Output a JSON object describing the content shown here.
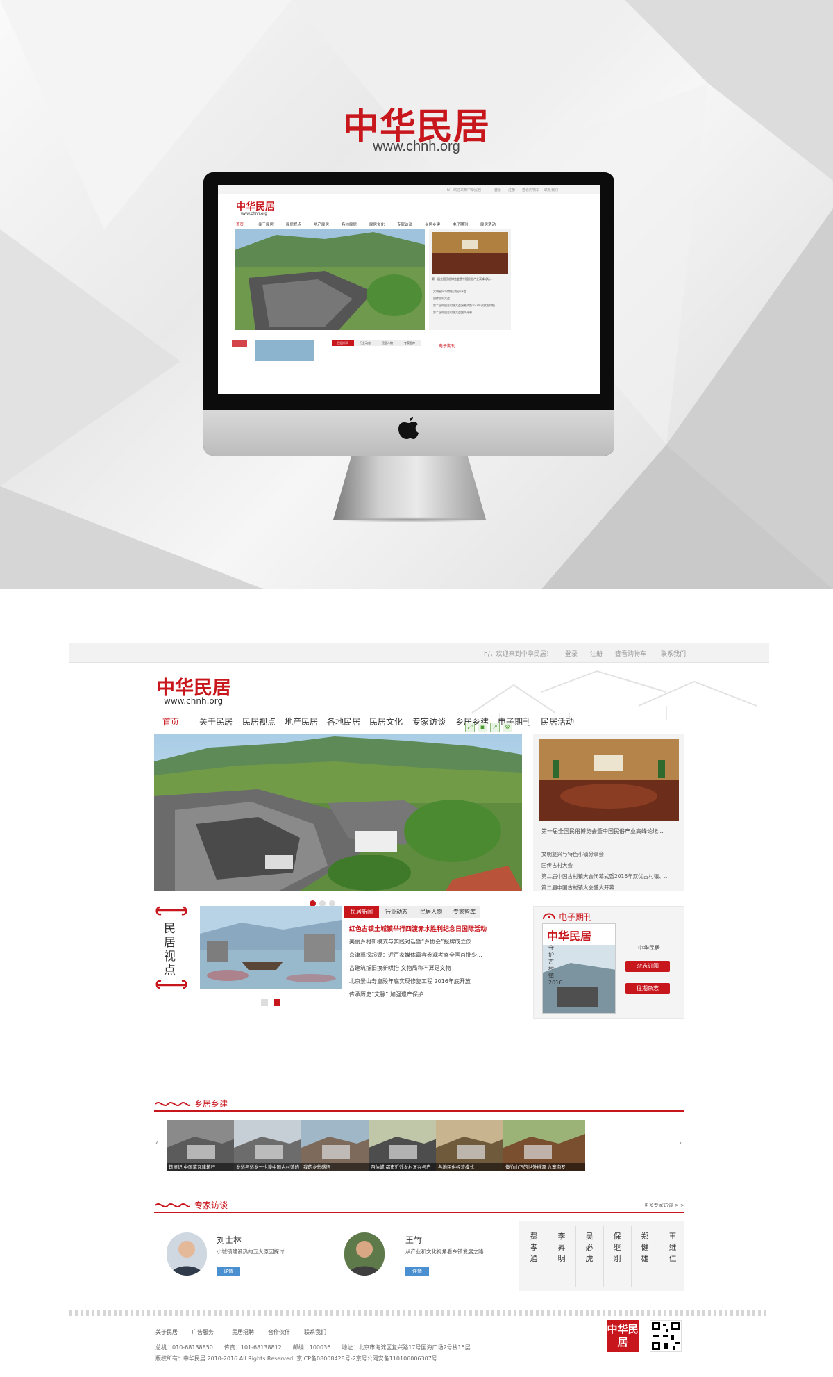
{
  "hero": {
    "logo_text": "中华民居",
    "url_text": "www.chnh.org",
    "apple_glyph": "apple-logo"
  },
  "mini": {
    "logo_text": "中华民居",
    "url_text": "www.chnh.org",
    "topbar": [
      "h/，欢迎来到中华民居！",
      "登录",
      "注册",
      "查看购物车",
      "联系我们"
    ],
    "nav": [
      "首页",
      "关于民居",
      "民居视点",
      "地产民居",
      "各地民居",
      "民居文化",
      "专家访谈",
      "乡居乡建",
      "电子期刊",
      "民居活动"
    ],
    "caption": "第一届全国民俗博览会暨中国民俗产业高峰论坛...",
    "list": [
      "文明复兴与特色小镇分享会",
      "国传古村大会",
      "第二届中国古村镇大会闭幕式暨2016年双优古村镇...",
      "第二届中国古村镇大会盛大开幕"
    ],
    "tabs": [
      "民居新闻",
      "行业动态",
      "民居人物",
      "专家智库"
    ],
    "mag_title": "电子期刊"
  },
  "site": {
    "topbar": {
      "welcome": "h/，欢迎来到中华民居！",
      "login": "登录",
      "register": "注册",
      "cart": "查看购物车",
      "contact": "联系我们"
    },
    "logo_text": "中华民居",
    "url_text": "www.chnh.org",
    "nav": [
      "首页",
      "关于民居",
      "民居视点",
      "地产民居",
      "各地民居",
      "民居文化",
      "专家访谈",
      "乡居乡建",
      "电子期刊",
      "民居活动"
    ],
    "toolbar_icons": [
      "expand-icon",
      "save-icon",
      "share-icon",
      "settings-icon"
    ],
    "featured": {
      "caption": "第一届全国民俗博览会暨中国民俗产业高峰论坛...",
      "list": [
        "文明复兴与特色小镇分享会",
        "国传古村大会",
        "第二届中国古村镇大会闭幕式暨2016年双优古村镇、...",
        "第二届中国古村镇大会盛大开幕"
      ]
    },
    "viewpoint": {
      "label_chars": [
        "民",
        "居",
        "视",
        "点"
      ],
      "tabs": [
        "民居新闻",
        "行业动态",
        "民居人物",
        "专家智库"
      ],
      "headline": "红色古镇土城镇举行四渡赤水胜利纪念日国际活动",
      "news": [
        "美丽乡村新模式与实践对话暨“乡协会”报牌成立仪...",
        "京津冀探起源：近百家媒体嘉宾参观考察全国首批少...",
        "古建筑拆旧换新哄抬 文物局称不算是文物",
        "北京景山寿皇殿年底实现修复工程 2016年底开放",
        "传承历史“文脉” 加强遗产保护"
      ]
    },
    "magazine": {
      "title": "电子期刊",
      "cover_title": "中华民居",
      "cover_sub": "守护古村镇 2016",
      "name": "中华民居",
      "subscribe_btn": "杂志订阅",
      "past_btn": "往期杂志"
    },
    "rural": {
      "title": "乡居乡建",
      "items": [
        "筑屋记 中国黛瓦建筑行",
        "乡愁与愁乡一也谈中国古村落的",
        "我的乡愁感悟",
        "西伯城 都市近郊乡村复兴与产",
        "各地民俗经营模式",
        "傣竹山下的世外桃源 九寨沟罗"
      ],
      "prev": "‹",
      "next": "›"
    },
    "experts": {
      "title": "专家访谈",
      "more": "更多专家访谈 > >",
      "people": [
        {
          "name": "刘士林",
          "desc": "小城镇建设热的五大原因探讨",
          "btn": "详情"
        },
        {
          "name": "王竹",
          "desc": "从产业和文化视角看乡镇发展之路",
          "btn": "详情"
        }
      ],
      "names": [
        "费孝通",
        "李昇明",
        "吴必虎",
        "保继刚",
        "郑健雄",
        "王维仁"
      ]
    },
    "footer": {
      "links": [
        "关于民居",
        "广告服务",
        "民居招聘",
        "合作伙伴",
        "联系我们"
      ],
      "contact_line": "总机：010-68138850　　传真：101-68138812　　邮编：100036　　地址：北京市海淀区复兴路17号国海广场2号楼15层",
      "copyright": "版权所有：中华民居 2010-2016 All Rights Reserved. 京ICP备08008428号-2京号公网安备110106006307号",
      "logo_text": "中华民居"
    }
  },
  "colors": {
    "brand_red": "#c8161d",
    "link_blue": "#4a8fd0"
  }
}
